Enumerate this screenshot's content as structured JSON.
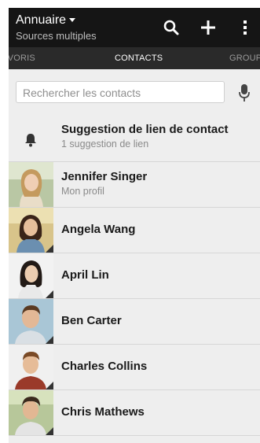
{
  "header": {
    "title": "Annuaire",
    "subtitle": "Sources multiples",
    "icons": [
      "search-icon",
      "add-icon",
      "overflow-menu-icon"
    ]
  },
  "tabs": {
    "left": "AVORIS",
    "center": "CONTACTS",
    "right": "GROUPE"
  },
  "search": {
    "placeholder": "Rechercher les contacts",
    "mic_icon": "microphone-icon"
  },
  "suggestion": {
    "title": "Suggestion de lien de contact",
    "subtitle": "1 suggestion de lien",
    "icon": "bell-icon"
  },
  "contacts": [
    {
      "name": "Jennifer Singer",
      "subtitle": "Mon profil"
    },
    {
      "name": "Angela Wang"
    },
    {
      "name": "April Lin"
    },
    {
      "name": "Ben Carter"
    },
    {
      "name": "Charles Collins"
    },
    {
      "name": "Chris Mathews"
    }
  ],
  "colors": {
    "header_bg": "#151515",
    "tabs_bg": "#2a2a2a",
    "list_bg": "#eeeeee",
    "divider": "#d6d6d6"
  }
}
